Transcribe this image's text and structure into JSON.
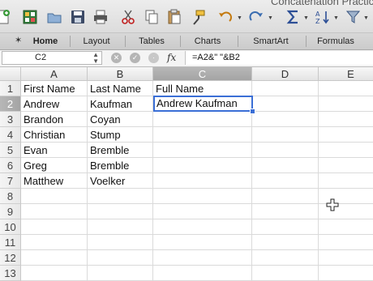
{
  "window": {
    "title": "Concatenation Practic"
  },
  "ribbon": {
    "tabs": [
      "Home",
      "Layout",
      "Tables",
      "Charts",
      "SmartArt",
      "Formulas"
    ]
  },
  "formula_bar": {
    "name_box": "C2",
    "fx_label": "fx",
    "formula": "=A2&\" \"&B2"
  },
  "sheet": {
    "columns": [
      "A",
      "B",
      "C",
      "D",
      "E"
    ],
    "rows": [
      "1",
      "2",
      "3",
      "4",
      "5",
      "6",
      "7",
      "8",
      "9",
      "10",
      "11",
      "12",
      "13"
    ],
    "selected_cell": "C2",
    "cells": [
      [
        "First Name",
        "Last Name",
        "Full Name",
        "",
        ""
      ],
      [
        "Andrew",
        "Kaufman",
        "Andrew Kaufman",
        "",
        ""
      ],
      [
        "Brandon",
        "Coyan",
        "",
        "",
        ""
      ],
      [
        "Christian",
        "Stump",
        "",
        "",
        ""
      ],
      [
        "Evan",
        "Bremble",
        "",
        "",
        ""
      ],
      [
        "Greg",
        "Bremble",
        "",
        "",
        ""
      ],
      [
        "Matthew",
        "Voelker",
        "",
        "",
        ""
      ],
      [
        "",
        "",
        "",
        "",
        ""
      ],
      [
        "",
        "",
        "",
        "",
        ""
      ],
      [
        "",
        "",
        "",
        "",
        ""
      ],
      [
        "",
        "",
        "",
        "",
        ""
      ],
      [
        "",
        "",
        "",
        "",
        ""
      ],
      [
        "",
        "",
        "",
        "",
        ""
      ]
    ]
  },
  "colors": {
    "selection": "#3b6fd6",
    "header_selected": "#aaaaaa"
  }
}
